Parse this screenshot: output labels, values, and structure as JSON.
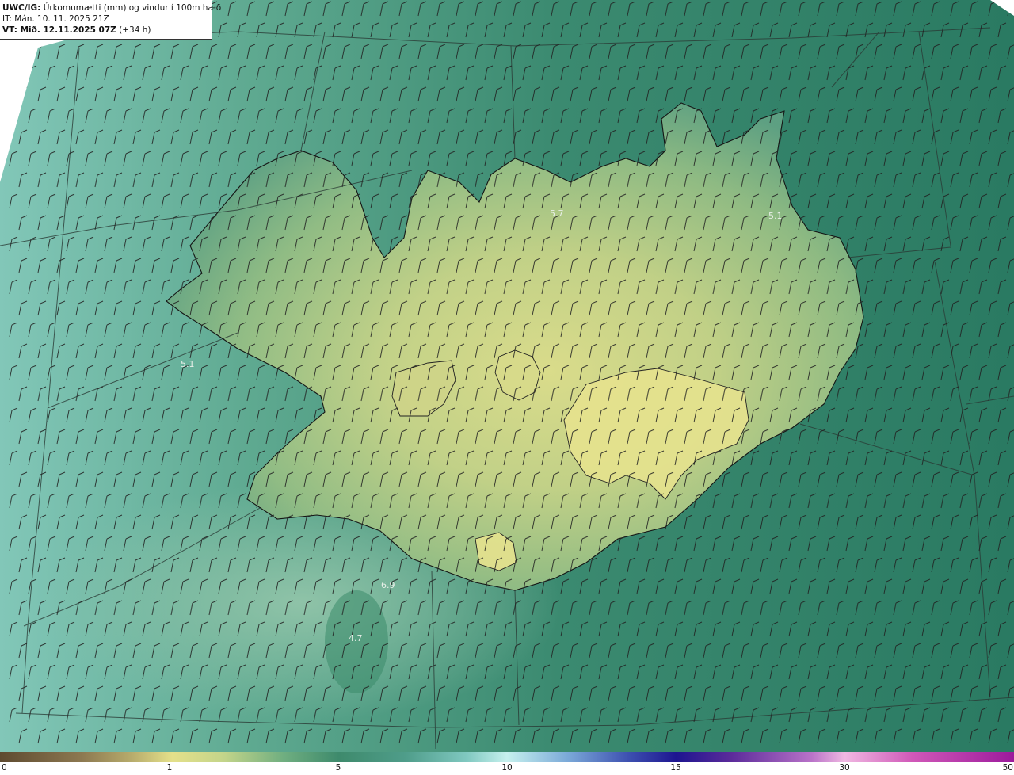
{
  "header": {
    "model": "UWC/IG:",
    "title": "Úrkomumætti (mm) og vindur í 100m hæð",
    "initial_time": "IT: Mán. 10. 11. 2025 21Z",
    "valid_label": "VT: Mið. 12.11.2025 07Z",
    "valid_offset": " (+34 h)"
  },
  "map": {
    "region": "Iceland",
    "field": "precipitable water (mm)",
    "wind": "wind barbs at 100 m",
    "ocean_color": "#2f8068",
    "highland_color": "#e4e08a",
    "west_sea_color": "#7fc2b4",
    "coastline_color": "#1a1a1a",
    "barb_color": "#222222"
  },
  "labels": [
    "5.7",
    "5.1",
    "5.1",
    "6.9",
    "4.7"
  ],
  "colorbar": {
    "ticks": [
      "0",
      "1",
      "5",
      "10",
      "15",
      "30",
      "50"
    ]
  }
}
